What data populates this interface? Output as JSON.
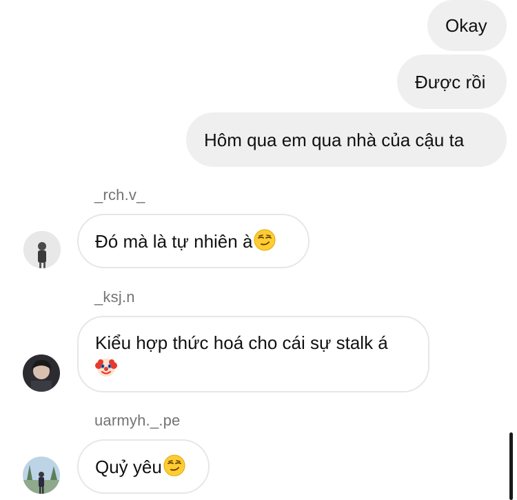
{
  "outgoing": [
    {
      "text": "Okay"
    },
    {
      "text": "Được rồi"
    },
    {
      "text": "Hôm qua em qua nhà của cậu ta"
    }
  ],
  "incoming": [
    {
      "username": "_rch.v_",
      "text": "Đó mà là tự nhiên à",
      "emoji": "smirking-face-emoji",
      "avatar": "avatar-rch"
    },
    {
      "username": "_ksj.n",
      "text": "Kiểu hợp thức hoá cho cái sự stalk á",
      "emoji": "clown-face-emoji",
      "avatar": "avatar-ksj"
    },
    {
      "username": "uarmyh._.pe",
      "text": "Quỷ yêu",
      "emoji": "smirking-face-emoji",
      "avatar": "avatar-uarmyh"
    }
  ],
  "colors": {
    "outgoing_bubble": "#efefef",
    "incoming_border": "#e6e6e6",
    "username": "#737373",
    "text": "#111111"
  }
}
